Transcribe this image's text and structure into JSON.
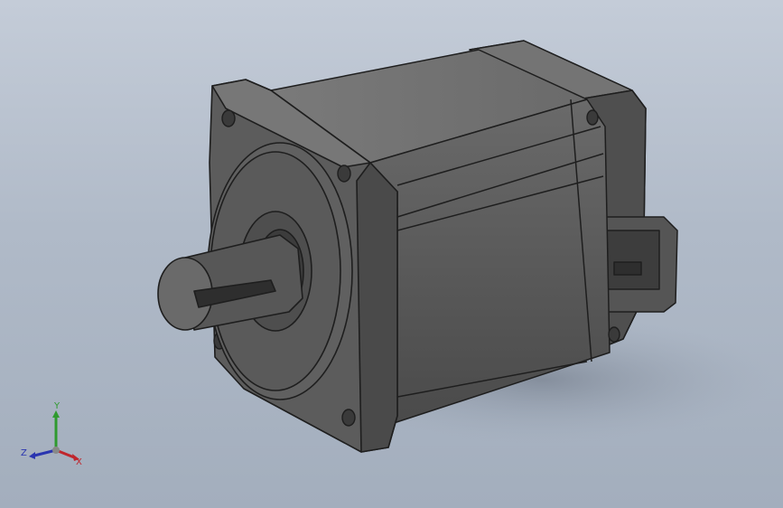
{
  "viewport": {
    "background_top": "#c4ccd8",
    "background_bottom": "#a3aebd"
  },
  "model": {
    "body_color": "#5a5a5a",
    "edge_color": "#1e1e1e"
  },
  "triad": {
    "x_label": "X",
    "y_label": "Y",
    "z_label": "Z",
    "x_color": "#c0262d",
    "y_color": "#2f9a2f",
    "z_color": "#2a35b0"
  }
}
